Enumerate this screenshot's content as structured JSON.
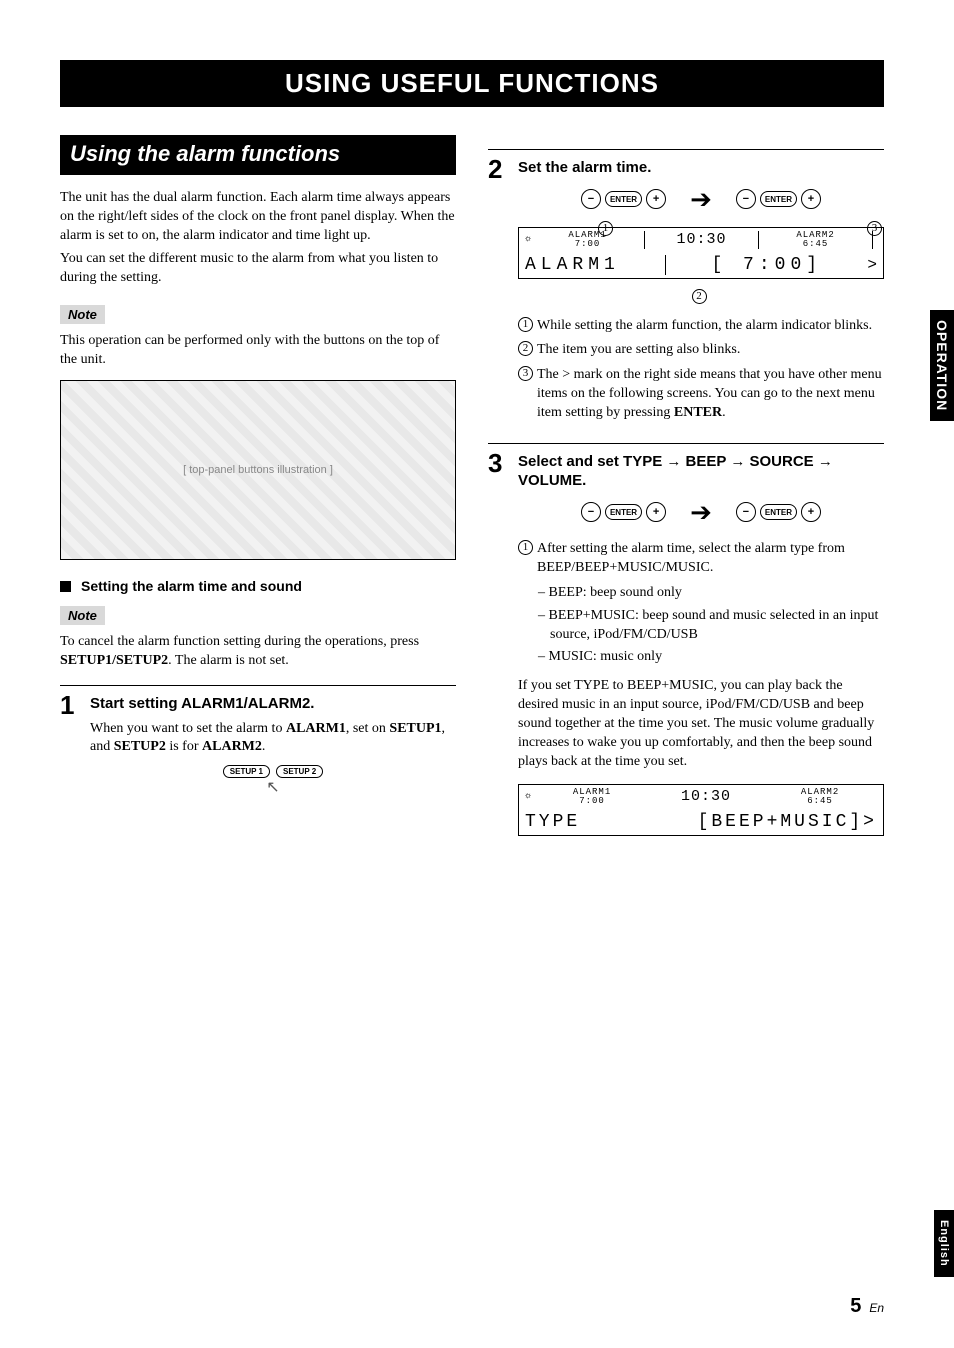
{
  "tabs": {
    "operation": "OPERATION",
    "english": "English"
  },
  "banner": "USING USEFUL FUNCTIONS",
  "left": {
    "subtitle": "Using the alarm functions",
    "intro1": "The unit has the dual alarm function. Each alarm time always appears on the right/left sides of the clock on the front panel display. When the alarm is set to on, the alarm indicator and time light up.",
    "intro2": "You can set the different music to the alarm from what you listen to during the setting.",
    "noteLabel": "Note",
    "note1": "This operation can be performed only with the buttons on the top of the unit.",
    "figureAlt": "[ top-panel buttons illustration ]",
    "sectionHead": "Setting the alarm time and sound",
    "note2a": "To cancel the alarm function setting during the operations, press ",
    "note2b": ". The alarm is not set.",
    "setup12": "SETUP1/SETUP2",
    "step1": {
      "num": "1",
      "head": "Start setting ALARM1/ALARM2.",
      "body1": "When you want to set the alarm to ",
      "alarm1": "ALARM1",
      "body2": ", set on ",
      "setup1": "SETUP1",
      "body3": ", and ",
      "setup2": "SETUP2",
      "body4": " is for ",
      "alarm2": "ALARM2",
      "body5": ".",
      "btn1": "SETUP 1",
      "btn2": "SETUP 2"
    }
  },
  "right": {
    "step2": {
      "num": "2",
      "head": "Set the alarm time.",
      "btnMinus": "−",
      "btnEnter": "ENTER",
      "btnPlus": "+",
      "lcdTopLeftLabel": "ALARM1",
      "lcdTopLeft": "7:00",
      "lcdTopMid": "10:30",
      "lcdTopRightLabel": "ALARM2",
      "lcdTopRight": "6:45",
      "lcdMainLeft": "ALARM1",
      "lcdMainMid": "[  7:00]",
      "lcdChevron": ">",
      "callouts": {
        "c1n": "1",
        "c1": "While setting the alarm function, the alarm indicator blinks.",
        "c2n": "2",
        "c2": "The item you are setting also blinks.",
        "c3n": "3",
        "c3a": "The ",
        "c3gt": ">",
        "c3b": " mark on the right side means that you have other menu items on the following screens. You can go to the next menu item setting by pressing ",
        "enter": "ENTER",
        "c3c": "."
      }
    },
    "step3": {
      "num": "3",
      "headA": "Select and set TYPE ",
      "headB": " BEEP ",
      "headC": " SOURCE ",
      "headD": " VOLUME.",
      "arrow": "→",
      "c1n": "1",
      "c1": "After setting the alarm time, select the alarm type from BEEP/BEEP+MUSIC/MUSIC.",
      "sub1": "– BEEP: beep sound only",
      "sub2": "– BEEP+MUSIC: beep sound and music selected in an input source, iPod/FM/CD/USB",
      "sub3": "– MUSIC: music only",
      "para": "If you set TYPE to BEEP+MUSIC, you can play back the desired music in an input source, iPod/FM/CD/USB and beep sound together at the time you set. The music volume gradually increases to wake you up comfortably, and then the beep sound plays back at the time you set.",
      "lcdTopLeftLabel": "ALARM1",
      "lcdTopLeft": "7:00",
      "lcdTopMid": "10:30",
      "lcdTopRightLabel": "ALARM2",
      "lcdTopRight": "6:45",
      "lcdMainLeft": "TYPE",
      "lcdMainRight": "[BEEP+MUSIC]>",
      "btnMinus": "−",
      "btnEnter": "ENTER",
      "btnPlus": "+"
    }
  },
  "page": {
    "num": "5",
    "suffix": "En"
  }
}
